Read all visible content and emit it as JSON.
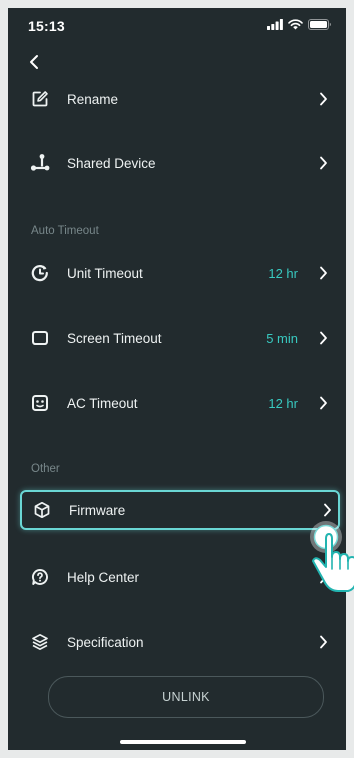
{
  "status_bar": {
    "time": "15:13"
  },
  "sections": {
    "auto_timeout": "Auto Timeout",
    "other": "Other"
  },
  "rows": {
    "rename": {
      "label": "Rename",
      "icon": "edit-icon"
    },
    "shared_device": {
      "label": "Shared Device",
      "icon": "share-nodes-icon"
    },
    "unit_timeout": {
      "label": "Unit Timeout",
      "value": "12 hr",
      "icon": "power-timer-icon"
    },
    "screen_timeout": {
      "label": "Screen Timeout",
      "value": "5 min",
      "icon": "screen-icon"
    },
    "ac_timeout": {
      "label": "AC Timeout",
      "value": "12 hr",
      "icon": "ac-outlet-icon"
    },
    "firmware": {
      "label": "Firmware",
      "icon": "cube-icon"
    },
    "help_center": {
      "label": "Help Center",
      "icon": "help-icon"
    },
    "specification": {
      "label": "Specification",
      "icon": "layers-icon"
    }
  },
  "unlink_button": "UNLINK",
  "colors": {
    "background": "#222b2e",
    "accent": "#38c9c0",
    "highlight_border": "#6ad6d4"
  }
}
